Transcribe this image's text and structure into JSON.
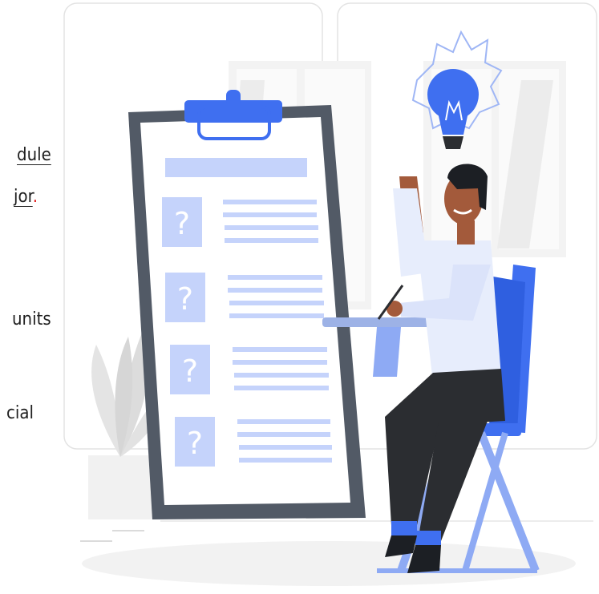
{
  "text_fragments": {
    "line1": "dule",
    "line2": "jor",
    "line2_period": ".",
    "line3": "units",
    "line4": "cial"
  },
  "illustration": {
    "description_icons": [
      "clipboard-icon",
      "question-mark-icon",
      "lightbulb-icon",
      "person-icon",
      "chair-icon",
      "plant-icon"
    ],
    "colors": {
      "accent": "#3f6ff0",
      "accent_light": "#c5d3fb",
      "clipboard_frame": "#525a66",
      "shirt": "#e7edfc",
      "pants": "#2b2d31",
      "skin": "#a35a3b",
      "hair": "#1c1f24"
    }
  }
}
